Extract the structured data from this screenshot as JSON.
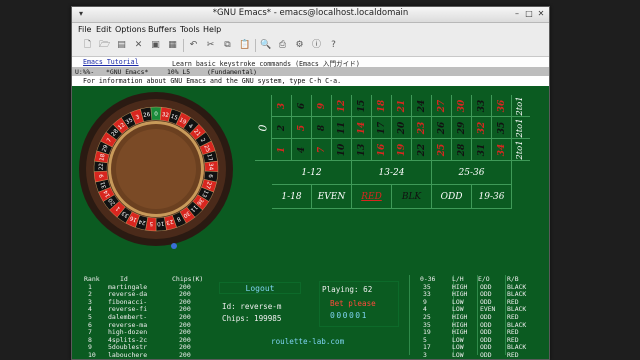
{
  "window": {
    "title": "*GNU Emacs* - emacs@localhost.localdomain"
  },
  "menu": [
    "File",
    "Edit",
    "Options",
    "Buffers",
    "Tools",
    "Help"
  ],
  "toolbar_icons": [
    "new-file-icon",
    "open-folder-icon",
    "open-dired-icon",
    "close-buffer-icon",
    "save-icon",
    "save-as-icon",
    "undo-icon",
    "cut-icon",
    "copy-icon",
    "paste-icon",
    "search-icon",
    "print-icon",
    "preferences-icon",
    "info-icon",
    "help-icon"
  ],
  "help": {
    "link": "Emacs Tutorial",
    "desc": "Learn basic keystroke commands (Emacs 入門ガイド)"
  },
  "modeline": {
    "status": "U:%%-",
    "buffer": "*GNU Emacs*",
    "position": "10% L5",
    "mode": "(Fundamental)"
  },
  "echo": "For information about GNU Emacs and the GNU system, type C-h C-a.",
  "colors": {
    "felt": "#0b5b21",
    "red": "#d8261f",
    "black": "#111111",
    "green": "#1a8a3a",
    "gold": "#f0c040"
  },
  "wheel_numbers": [
    0,
    32,
    15,
    19,
    4,
    21,
    2,
    25,
    17,
    34,
    6,
    27,
    13,
    36,
    11,
    30,
    8,
    23,
    10,
    5,
    24,
    16,
    33,
    1,
    20,
    14,
    31,
    9,
    22,
    18,
    29,
    7,
    28,
    12,
    35,
    3,
    26
  ],
  "board": {
    "zero": "0",
    "rows": [
      [
        {
          "n": "3",
          "c": "red"
        },
        {
          "n": "6",
          "c": "black"
        },
        {
          "n": "9",
          "c": "red"
        },
        {
          "n": "12",
          "c": "red"
        },
        {
          "n": "15",
          "c": "black"
        },
        {
          "n": "18",
          "c": "red"
        },
        {
          "n": "21",
          "c": "red"
        },
        {
          "n": "24",
          "c": "black"
        },
        {
          "n": "27",
          "c": "red"
        },
        {
          "n": "30",
          "c": "red"
        },
        {
          "n": "33",
          "c": "black"
        },
        {
          "n": "36",
          "c": "red"
        }
      ],
      [
        {
          "n": "2",
          "c": "black"
        },
        {
          "n": "5",
          "c": "red"
        },
        {
          "n": "8",
          "c": "black"
        },
        {
          "n": "11",
          "c": "black"
        },
        {
          "n": "14",
          "c": "red"
        },
        {
          "n": "17",
          "c": "black"
        },
        {
          "n": "20",
          "c": "black"
        },
        {
          "n": "23",
          "c": "red"
        },
        {
          "n": "26",
          "c": "black"
        },
        {
          "n": "29",
          "c": "black"
        },
        {
          "n": "32",
          "c": "red"
        },
        {
          "n": "35",
          "c": "black"
        }
      ],
      [
        {
          "n": "1",
          "c": "red"
        },
        {
          "n": "4",
          "c": "black"
        },
        {
          "n": "7",
          "c": "red"
        },
        {
          "n": "10",
          "c": "black"
        },
        {
          "n": "13",
          "c": "black"
        },
        {
          "n": "16",
          "c": "red"
        },
        {
          "n": "19",
          "c": "red"
        },
        {
          "n": "22",
          "c": "black"
        },
        {
          "n": "25",
          "c": "red"
        },
        {
          "n": "28",
          "c": "black"
        },
        {
          "n": "31",
          "c": "black"
        },
        {
          "n": "34",
          "c": "red"
        }
      ]
    ],
    "columns": [
      "2to1",
      "2to1",
      "2to1"
    ],
    "dozens": [
      "1-12",
      "13-24",
      "25-36"
    ],
    "outside": [
      {
        "label": "1-18",
        "color": "white"
      },
      {
        "label": "EVEN",
        "color": "white"
      },
      {
        "label": "RED",
        "color": "red"
      },
      {
        "label": "BLK",
        "color": "black"
      },
      {
        "label": "ODD",
        "color": "white"
      },
      {
        "label": "19-36",
        "color": "white"
      }
    ]
  },
  "leaderboard": {
    "headers": {
      "rank": "Rank",
      "id": "Id",
      "chips": "Chips(K)"
    },
    "rows": [
      {
        "rank": "1",
        "id": "martingale",
        "chips": "200"
      },
      {
        "rank": "2",
        "id": "reverse-da",
        "chips": "200"
      },
      {
        "rank": "3",
        "id": "fibonacci-",
        "chips": "200"
      },
      {
        "rank": "4",
        "id": "reverse-fi",
        "chips": "200"
      },
      {
        "rank": "5",
        "id": "dalembert-",
        "chips": "200"
      },
      {
        "rank": "6",
        "id": "reverse-ma",
        "chips": "200"
      },
      {
        "rank": "7",
        "id": "high-dozen",
        "chips": "200"
      },
      {
        "rank": "8",
        "id": "4splits-2c",
        "chips": "200"
      },
      {
        "rank": "9",
        "id": "5doublestr",
        "chips": "200"
      },
      {
        "rank": "10",
        "id": "labouchere",
        "chips": "200"
      }
    ]
  },
  "player": {
    "logout": "Logout",
    "id_label": "Id:",
    "id_value": "reverse-m",
    "chips_label": "Chips:",
    "chips_value": "199985",
    "playing_label": "Playing:",
    "playing_value": "62",
    "bet_please": "Bet please",
    "timer": "000001",
    "site": "roulette-lab.com"
  },
  "history": {
    "headers": {
      "num": "0-36",
      "lh": "L/H",
      "eo": "E/O",
      "rb": "R/B"
    },
    "rows": [
      {
        "num": "35",
        "lh": "HIGH",
        "eo": "ODD",
        "rb": "BLACK"
      },
      {
        "num": "33",
        "lh": "HIGH",
        "eo": "ODD",
        "rb": "BLACK"
      },
      {
        "num": "9",
        "lh": "LOW",
        "eo": "ODD",
        "rb": "RED"
      },
      {
        "num": "4",
        "lh": "LOW",
        "eo": "EVEN",
        "rb": "BLACK"
      },
      {
        "num": "25",
        "lh": "HIGH",
        "eo": "ODD",
        "rb": "RED"
      },
      {
        "num": "35",
        "lh": "HIGH",
        "eo": "ODD",
        "rb": "BLACK"
      },
      {
        "num": "19",
        "lh": "HIGH",
        "eo": "ODD",
        "rb": "RED"
      },
      {
        "num": "5",
        "lh": "LOW",
        "eo": "ODD",
        "rb": "RED"
      },
      {
        "num": "17",
        "lh": "LOW",
        "eo": "ODD",
        "rb": "BLACK"
      },
      {
        "num": "3",
        "lh": "LOW",
        "eo": "ODD",
        "rb": "RED"
      }
    ]
  }
}
